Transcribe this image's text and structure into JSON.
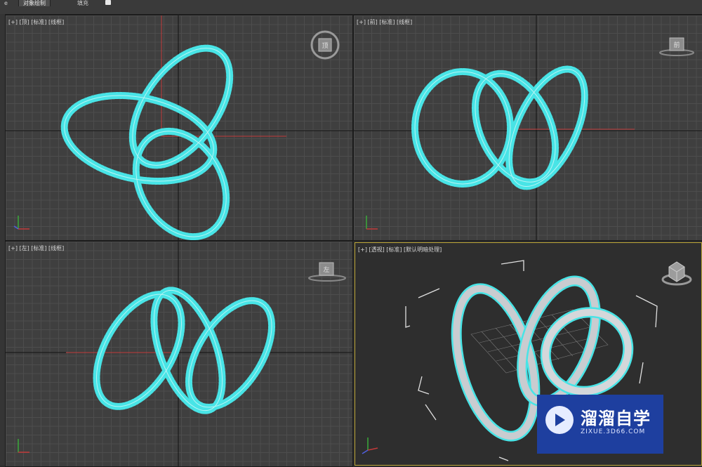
{
  "tabs": [
    {
      "label": "e"
    },
    {
      "label": "对象绘制"
    },
    {
      "label": "填充"
    }
  ],
  "viewports": {
    "top": {
      "label": "[+] [顶] [标准] [线框]",
      "viewcube": "顶"
    },
    "front": {
      "label": "[+] [前] [标准] [线框]",
      "viewcube": "前"
    },
    "left": {
      "label": "[+] [左] [标准] [线框]",
      "viewcube": "左"
    },
    "perspective": {
      "label": "[+] [透视] [标准] [默认明暗处理]"
    }
  },
  "watermark": {
    "title": "溜溜自学",
    "url": "ZIXUE.3D66.COM"
  },
  "colors": {
    "wire": "#48e4e6",
    "axis_x": "#c23a3a",
    "axis_y": "#3aaa3a",
    "axis_z": "#5060e0",
    "grid_major": "#111111"
  },
  "icons": [
    "viewcube-icon",
    "axis-gizmo-icon",
    "play-logo-icon"
  ]
}
